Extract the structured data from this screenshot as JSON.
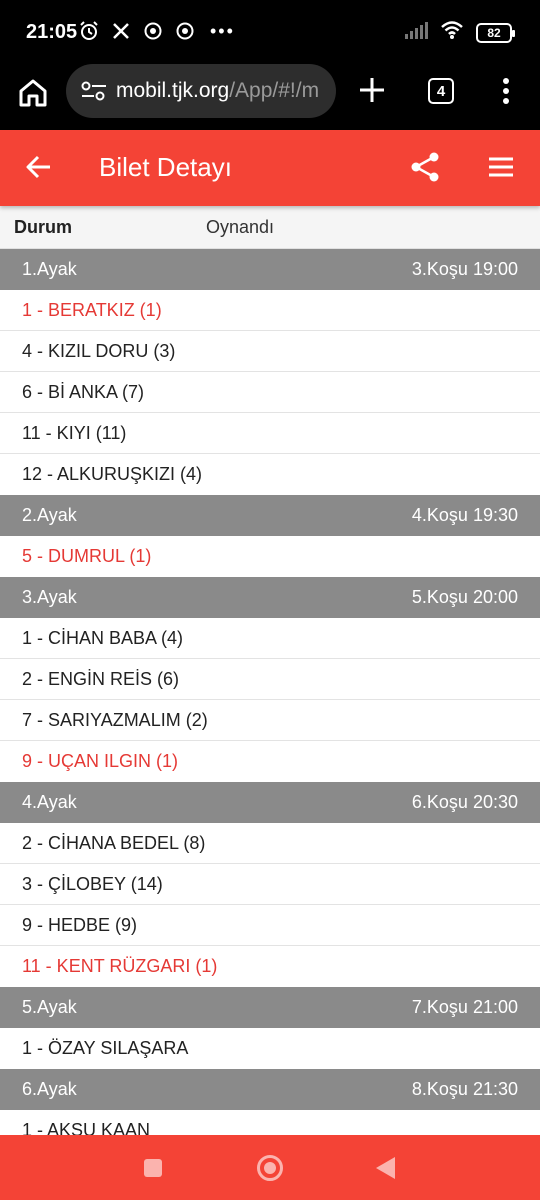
{
  "status_bar": {
    "time": "21:05",
    "battery": "82",
    "icons": [
      "alarm-icon",
      "x-app-icon",
      "chrome-icon",
      "chrome-icon",
      "more-dots-icon",
      "signal-icon",
      "wifi-icon",
      "battery-icon"
    ]
  },
  "browser": {
    "url_host": "mobil.tjk.org",
    "url_path": "/App/#!/m",
    "tab_count": "4"
  },
  "app_bar": {
    "title": "Bilet Detayı"
  },
  "ticket": {
    "status_label": "Durum",
    "status_value": "Oynandı"
  },
  "legs": [
    {
      "leg": "1.Ayak",
      "race": "3.Koşu 19:00",
      "runners": [
        {
          "text": "1 - BERATKIZ (1)",
          "winner": true
        },
        {
          "text": "4 - KIZIL DORU (3)",
          "winner": false
        },
        {
          "text": "6 - Bİ ANKA (7)",
          "winner": false
        },
        {
          "text": "11 - KIYI (11)",
          "winner": false
        },
        {
          "text": "12 - ALKURUŞKIZI (4)",
          "winner": false
        }
      ]
    },
    {
      "leg": "2.Ayak",
      "race": "4.Koşu 19:30",
      "runners": [
        {
          "text": "5 - DUMRUL (1)",
          "winner": true
        }
      ]
    },
    {
      "leg": "3.Ayak",
      "race": "5.Koşu 20:00",
      "runners": [
        {
          "text": "1 - CİHAN BABA (4)",
          "winner": false
        },
        {
          "text": "2 - ENGİN REİS (6)",
          "winner": false
        },
        {
          "text": "7 - SARIYAZMALIM (2)",
          "winner": false
        },
        {
          "text": "9 - UÇAN ILGIN (1)",
          "winner": true
        }
      ]
    },
    {
      "leg": "4.Ayak",
      "race": "6.Koşu 20:30",
      "runners": [
        {
          "text": "2 - CİHANA BEDEL (8)",
          "winner": false
        },
        {
          "text": "3 - ÇİLOBEY (14)",
          "winner": false
        },
        {
          "text": "9 - HEDBE (9)",
          "winner": false
        },
        {
          "text": "11 - KENT RÜZGARI (1)",
          "winner": true
        }
      ]
    },
    {
      "leg": "5.Ayak",
      "race": "7.Koşu 21:00",
      "runners": [
        {
          "text": "1 - ÖZAY SILAŞARA",
          "winner": false
        }
      ]
    },
    {
      "leg": "6.Ayak",
      "race": "8.Koşu 21:30",
      "runners": [
        {
          "text": "1 - AKSU KAAN",
          "winner": false
        }
      ]
    }
  ],
  "colors": {
    "accent": "#f44336",
    "winner_text": "#e53935",
    "leg_header": "#8a8a8a"
  }
}
